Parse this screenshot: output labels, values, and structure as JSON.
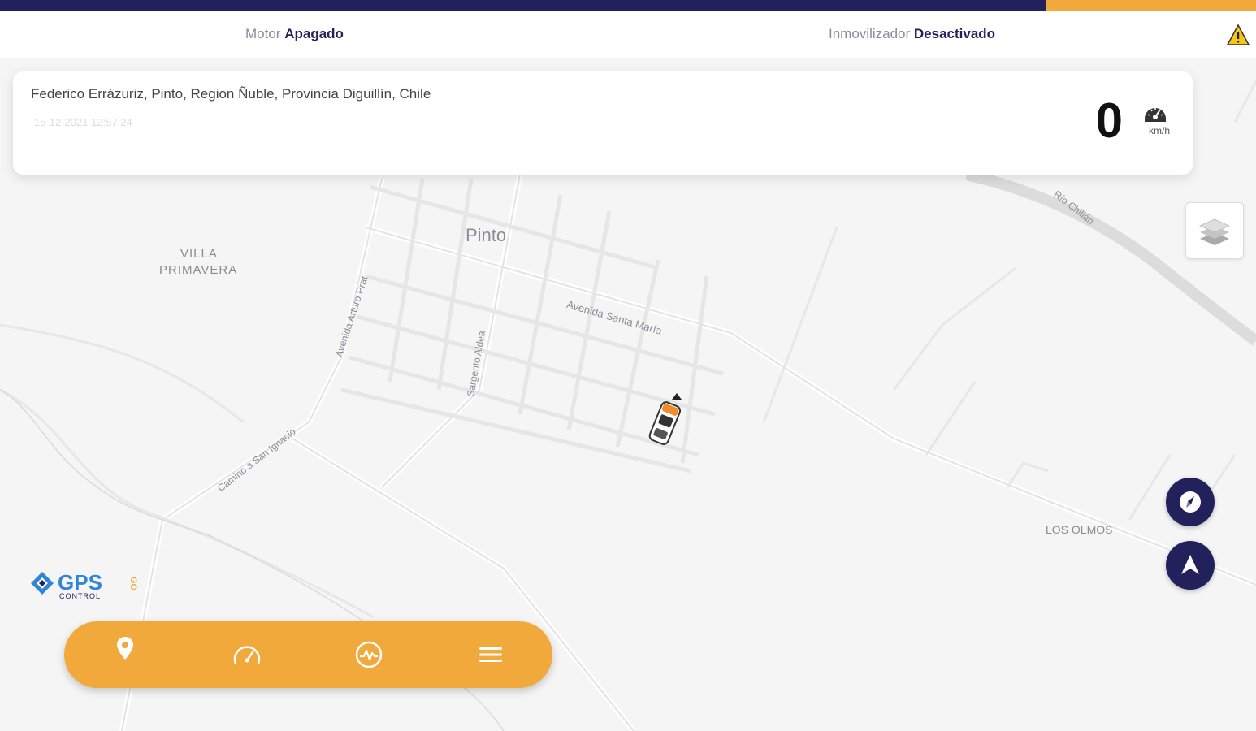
{
  "status": {
    "motor_label": "Motor",
    "motor_value": "Apagado",
    "immobilizer_label": "Inmovilizador",
    "immobilizer_value": "Desactivado",
    "warning_icon": "warning-icon"
  },
  "location_card": {
    "address": "Federico Errázuriz, Pinto, Region Ñuble, Provincia Diguillín, Chile",
    "timestamp": "15-12-2021 12:57:24",
    "speed": "0",
    "speed_unit": "km/h",
    "speed_icon": "speedometer-icon"
  },
  "map": {
    "labels": {
      "town": "Pinto",
      "villa_line1": "VILLA",
      "villa_line2": "PRIMAVERA",
      "avenida_santa_maria": "Avenida Santa María",
      "avenida_arturo_prat": "Avenida Arturo Prat",
      "sargento_aldea": "Sargento Aldea",
      "camino_san_ignacio": "Camino a San Ignacio",
      "rio_chillan": "Río Chillán",
      "los_olmos": "LOS OLMOS"
    }
  },
  "logo": {
    "main": "GPS",
    "sub": "CONTROL",
    "suffix": "GO"
  },
  "controls": {
    "layers_icon": "layers-icon",
    "compass_icon": "compass-icon",
    "navigate_icon": "navigation-arrow-icon"
  },
  "bottom_nav": {
    "items": [
      "location-pin-icon",
      "speedometer-icon",
      "activity-icon",
      "menu-icon"
    ]
  },
  "colors": {
    "navy": "#23215c",
    "orange": "#f2a93b"
  }
}
